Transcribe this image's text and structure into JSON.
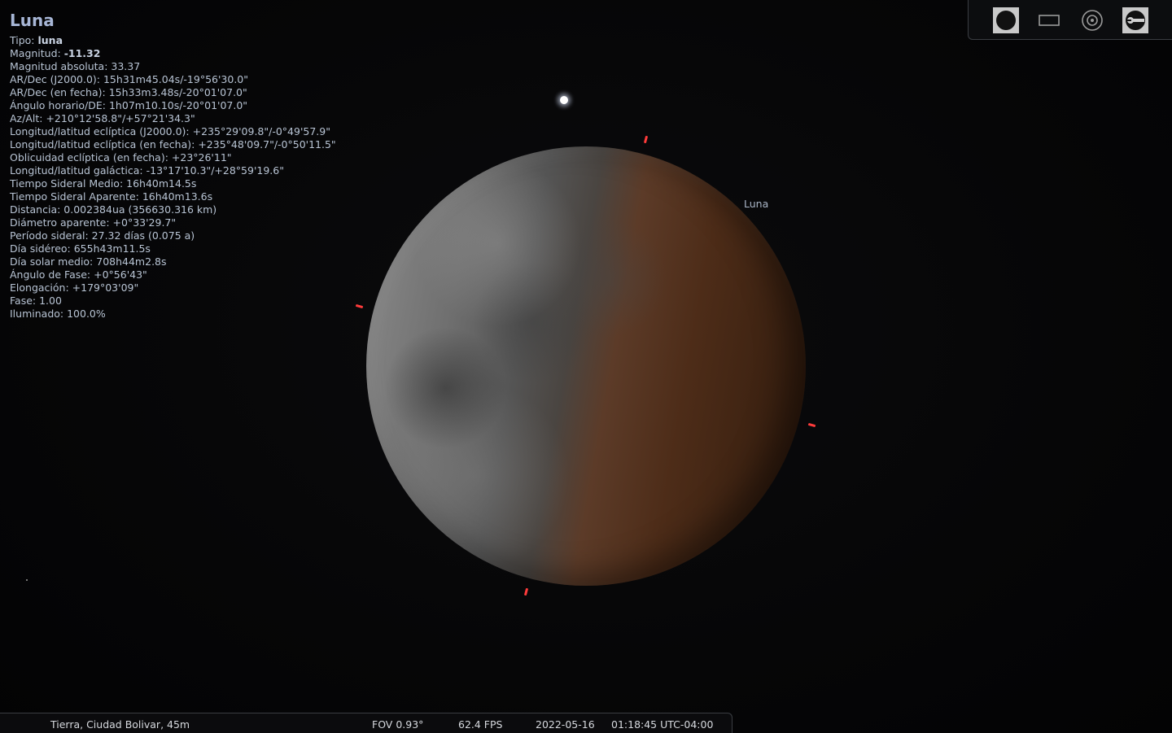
{
  "object": {
    "title": "Luna",
    "sky_label": "Luna",
    "info_lines": [
      {
        "label": "Tipo: ",
        "value": "luna",
        "bold": true
      },
      {
        "label": "Magnitud: ",
        "value": "-11.32",
        "bold": true
      },
      {
        "label": "Magnitud absoluta: ",
        "value": "33.37"
      },
      {
        "label": "AR/Dec (J2000.0): ",
        "value": "15h31m45.04s/-19°56'30.0\""
      },
      {
        "label": "AR/Dec (en fecha): ",
        "value": "15h33m3.48s/-20°01'07.0\""
      },
      {
        "label": "Ángulo horario/DE: ",
        "value": "1h07m10.10s/-20°01'07.0\""
      },
      {
        "label": "Az/Alt: ",
        "value": "+210°12'58.8\"/+57°21'34.3\""
      },
      {
        "label": "Longitud/latitud eclíptica (J2000.0): ",
        "value": "+235°29'09.8\"/-0°49'57.9\""
      },
      {
        "label": "Longitud/latitud eclíptica (en fecha): ",
        "value": "+235°48'09.7\"/-0°50'11.5\""
      },
      {
        "label": "Oblicuidad eclíptica (en fecha): ",
        "value": "+23°26'11\""
      },
      {
        "label": "Longitud/latitud galáctica: ",
        "value": "-13°17'10.3\"/+28°59'19.6\""
      },
      {
        "label": "Tiempo Sideral Medio: ",
        "value": "16h40m14.5s"
      },
      {
        "label": "Tiempo Sideral Aparente: ",
        "value": "16h40m13.6s"
      },
      {
        "label": "Distancia: ",
        "value": "0.002384ua (356630.316 km)"
      },
      {
        "label": "Diámetro aparente: ",
        "value": "+0°33'29.7\""
      },
      {
        "label": "Período sideral: ",
        "value": "27.32 días (0.075 a)"
      },
      {
        "label": "Día sidéreo: ",
        "value": "655h43m11.5s"
      },
      {
        "label": "Día solar medio: ",
        "value": "708h44m2.8s"
      },
      {
        "label": "Ángulo de Fase: ",
        "value": "+0°56'43\""
      },
      {
        "label": "Elongación: ",
        "value": "+179°03'09\""
      },
      {
        "label": "Fase: ",
        "value": "1.00"
      },
      {
        "label": "Iluminado: ",
        "value": "100.0%"
      }
    ]
  },
  "toolbar": {
    "buttons": [
      {
        "name": "ocular-icon"
      },
      {
        "name": "sensor-frame-icon"
      },
      {
        "name": "telrad-icon"
      },
      {
        "name": "settings-wrench-icon"
      }
    ]
  },
  "statusbar": {
    "location": "Tierra, Ciudad Bolivar, 45m",
    "fov": "FOV 0.93°",
    "fps": "62.4 FPS",
    "date": "2022-05-16",
    "time": "01:18:45 UTC-04:00"
  },
  "colors": {
    "marker": "#ff3b3b",
    "info_text": "#b8c4d4",
    "title": "#a7b6d6"
  }
}
